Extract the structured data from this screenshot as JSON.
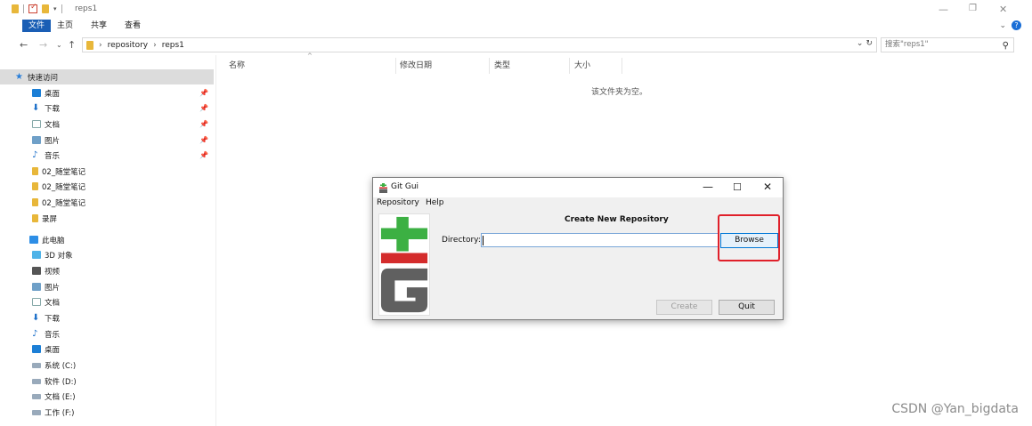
{
  "explorer": {
    "title": "reps1",
    "ribbon_tabs": [
      "文件",
      "主页",
      "共享",
      "查看"
    ],
    "breadcrumb": [
      "repository",
      "reps1"
    ],
    "search_placeholder": "搜索\"reps1\"",
    "columns": [
      "名称",
      "修改日期",
      "类型",
      "大小"
    ],
    "empty_message": "该文件夹为空。",
    "sidebar": [
      {
        "label": "快速访问",
        "icon": "star-icon",
        "pinned": false
      },
      {
        "label": "桌面",
        "icon": "desktop-icon",
        "pinned": true
      },
      {
        "label": "下载",
        "icon": "download-icon",
        "pinned": true
      },
      {
        "label": "文档",
        "icon": "document-icon",
        "pinned": true
      },
      {
        "label": "图片",
        "icon": "picture-icon",
        "pinned": true
      },
      {
        "label": "音乐",
        "icon": "music-icon",
        "pinned": true
      },
      {
        "label": "02_随堂笔记",
        "icon": "folder-icon",
        "pinned": false
      },
      {
        "label": "02_随堂笔记",
        "icon": "folder-icon",
        "pinned": false
      },
      {
        "label": "02_随堂笔记",
        "icon": "folder-icon",
        "pinned": false
      },
      {
        "label": "录屏",
        "icon": "folder-icon",
        "pinned": false
      },
      {
        "label": "此电脑",
        "icon": "computer-icon",
        "pinned": false
      },
      {
        "label": "3D 对象",
        "icon": "3d-objects-icon",
        "pinned": false
      },
      {
        "label": "视频",
        "icon": "video-icon",
        "pinned": false
      },
      {
        "label": "图片",
        "icon": "picture-icon",
        "pinned": false
      },
      {
        "label": "文档",
        "icon": "document-icon",
        "pinned": false
      },
      {
        "label": "下载",
        "icon": "download-icon",
        "pinned": false
      },
      {
        "label": "音乐",
        "icon": "music-icon",
        "pinned": false
      },
      {
        "label": "桌面",
        "icon": "desktop-icon",
        "pinned": false
      },
      {
        "label": "系统 (C:)",
        "icon": "drive-icon",
        "pinned": false
      },
      {
        "label": "软件 (D:)",
        "icon": "drive-icon",
        "pinned": false
      },
      {
        "label": "文档 (E:)",
        "icon": "drive-icon",
        "pinned": false
      },
      {
        "label": "工作 (F:)",
        "icon": "drive-icon",
        "pinned": false
      }
    ]
  },
  "gitgui": {
    "title": "Git Gui",
    "menu": [
      "Repository",
      "Help"
    ],
    "heading": "Create New Repository",
    "directory_label": "Directory:",
    "directory_value": "",
    "browse_label": "Browse",
    "create_label": "Create",
    "quit_label": "Quit"
  },
  "watermark": "CSDN @Yan_bigdata",
  "colors": {
    "ribbon_active": "#1a5eb5",
    "highlight": "#e0202a",
    "git_green": "#3cb043",
    "git_red": "#d42c2c",
    "git_gray": "#606060"
  }
}
